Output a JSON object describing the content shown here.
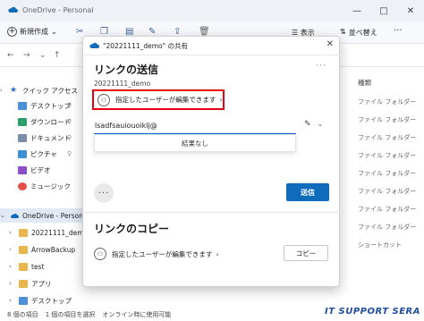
{
  "window": {
    "title": "OneDrive - Personal",
    "controls": [
      "—",
      "□",
      "✕"
    ]
  },
  "toolbar": {
    "new_label": "新規作成",
    "new_caret": "⌄",
    "sort_label": "並べ替え",
    "view_label": "表示",
    "more": "···"
  },
  "sidebar": {
    "items": [
      {
        "label": "クイック アクセス",
        "icon": "star-icon"
      },
      {
        "label": "デスクトップ",
        "icon": "desktop-icon",
        "pin": "📌"
      },
      {
        "label": "ダウンロード",
        "icon": "download-icon",
        "pin": "📌"
      },
      {
        "label": "ドキュメント",
        "icon": "documents-icon",
        "pin": "📌"
      },
      {
        "label": "ピクチャ",
        "icon": "pictures-icon",
        "pin": "📌"
      },
      {
        "label": "ビデオ",
        "icon": "video-icon"
      },
      {
        "label": "ミュージック",
        "icon": "music-icon"
      },
      {
        "label": "OneDrive - Personal",
        "icon": "onedrive-icon"
      },
      {
        "label": "20221111_demo",
        "icon": "folder-icon"
      },
      {
        "label": "ArrowBackup",
        "icon": "folder-icon"
      },
      {
        "label": "test",
        "icon": "folder-icon"
      },
      {
        "label": "アプリ",
        "icon": "folder-icon"
      },
      {
        "label": "デスクトップ",
        "icon": "folder-icon"
      }
    ]
  },
  "list": {
    "column_type": "種類",
    "rows": [
      "ファイル フォルダー",
      "ファイル フォルダー",
      "ファイル フォルダー",
      "ファイル フォルダー",
      "ファイル フォルダー",
      "ファイル フォルダー",
      "ファイル フォルダー",
      "ファイル フォルダー",
      "ショートカット"
    ]
  },
  "status": {
    "items": "8 個の項目",
    "selected": "1 個の項目を選択",
    "online": "オンライン時に使用可能"
  },
  "watermark": "IT SUPPORT SERA",
  "dialog": {
    "title": "\"20221111_demo\" の共有",
    "close": "✕",
    "send_section_title": "リンクの送信",
    "section_more": "···",
    "filename": "20221111_demo",
    "permission_text": "指定したユーザーが編集できます",
    "permission_caret": "›",
    "email_value": "lsadfsauiouoiklj@",
    "no_result": "結果なし",
    "more_options": "···",
    "send_label": "送信",
    "copy_section_title": "リンクのコピー",
    "copy_permission_text": "指定したユーザーが編集できます",
    "copy_caret": "›",
    "copy_label": "コピー"
  },
  "colors": {
    "accent": "#0f6cbd",
    "highlight_box": "#e60012",
    "watermark": "#1f4d9a"
  }
}
